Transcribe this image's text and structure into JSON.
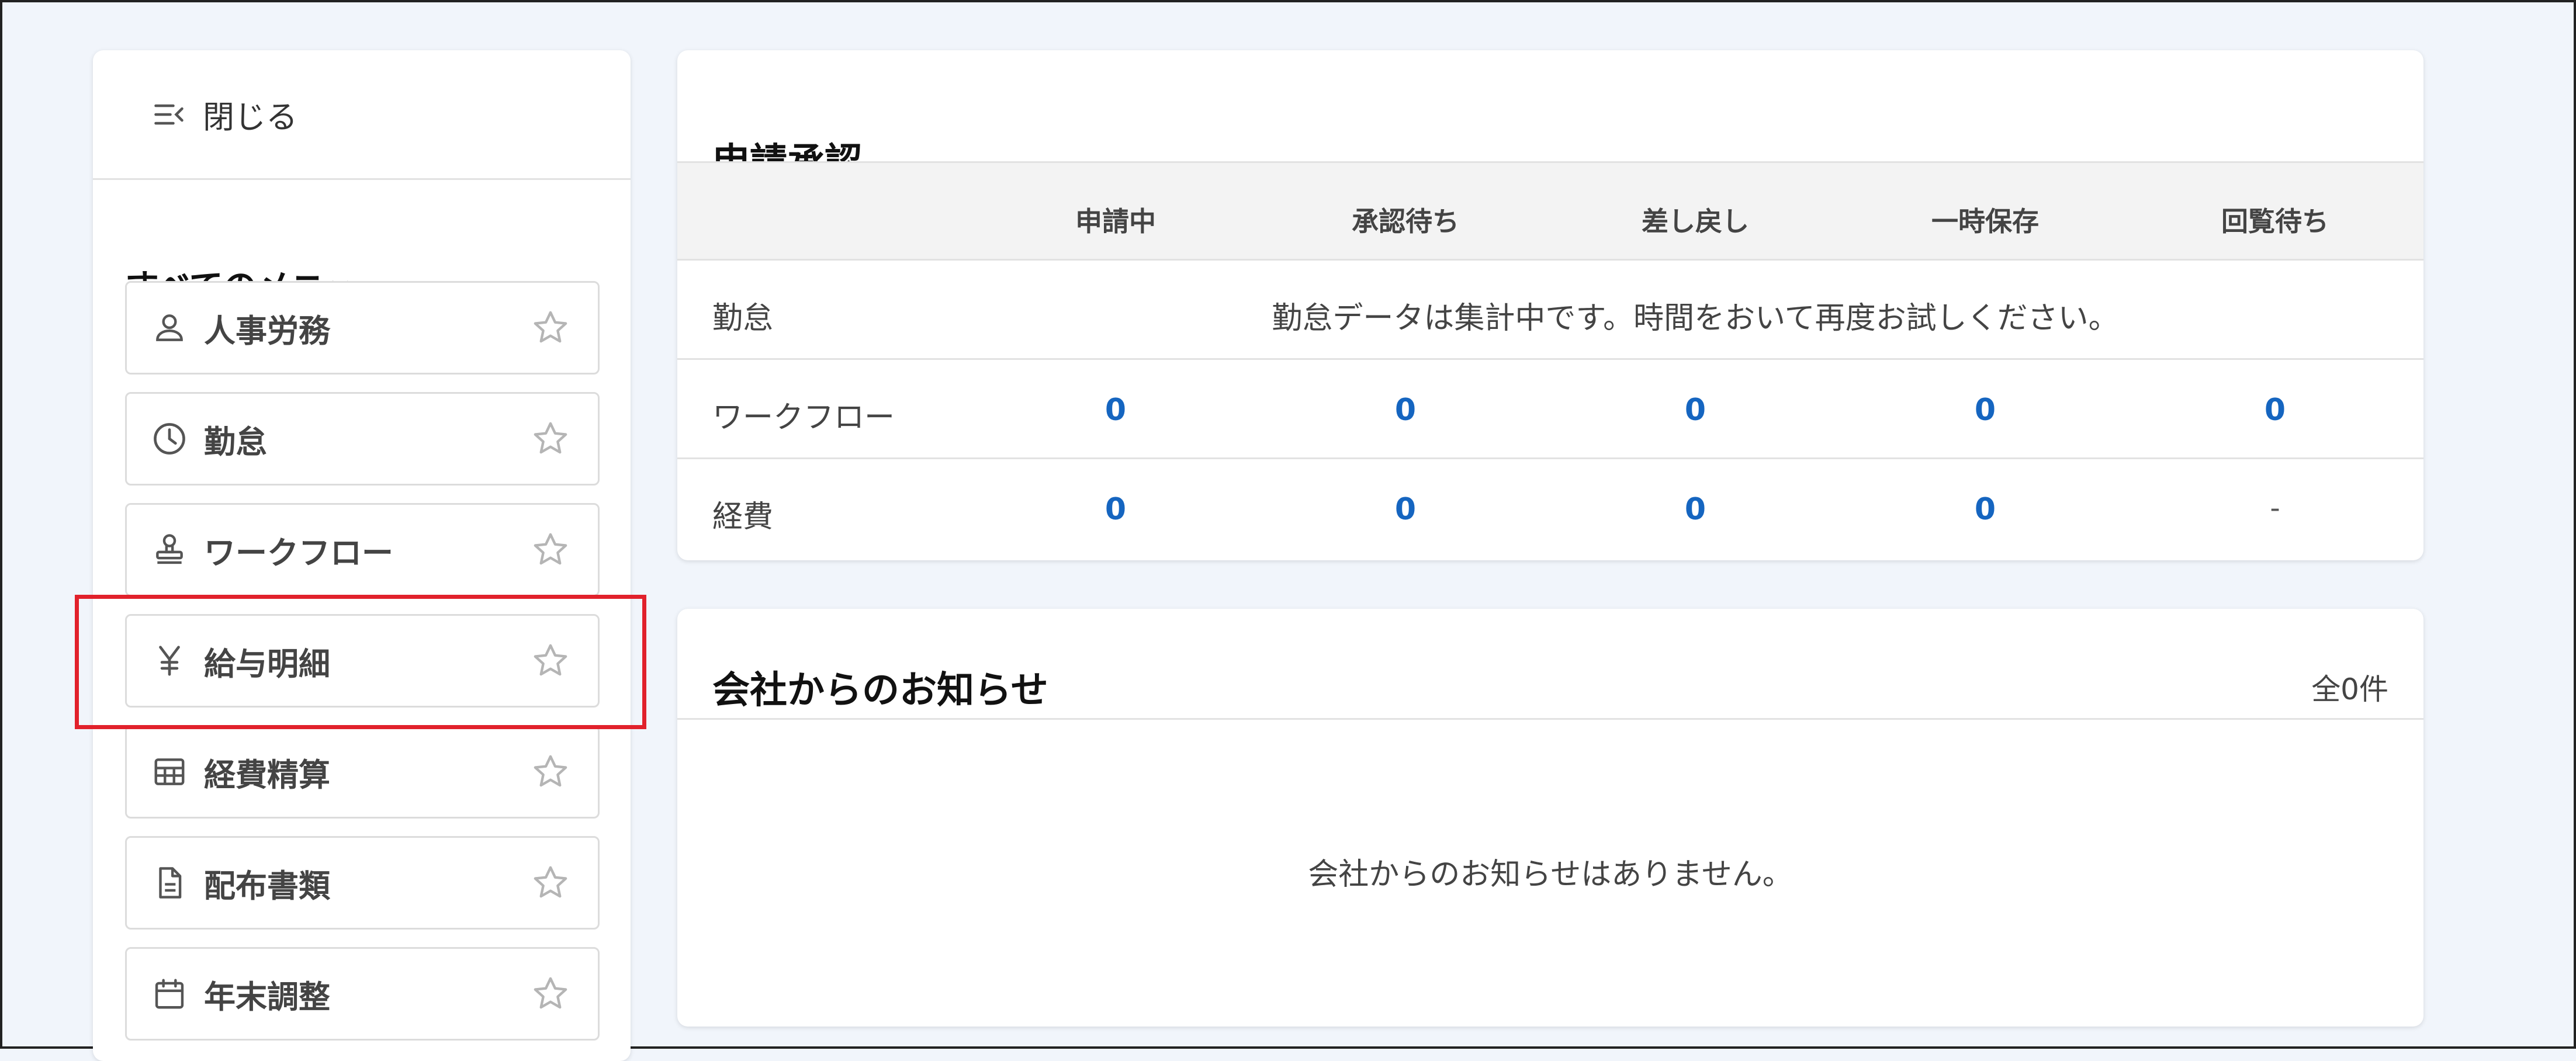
{
  "sidebar": {
    "close_label": "閉じる",
    "menu_title": "すべてのメニュー",
    "items": [
      {
        "label": "人事労務",
        "icon": "person-icon"
      },
      {
        "label": "勤怠",
        "icon": "clock-icon"
      },
      {
        "label": "ワークフロー",
        "icon": "stamp-icon"
      },
      {
        "label": "給与明細",
        "icon": "yen-icon"
      },
      {
        "label": "経費精算",
        "icon": "calculator-icon"
      },
      {
        "label": "配布書類",
        "icon": "document-icon"
      },
      {
        "label": "年末調整",
        "icon": "calendar-icon"
      }
    ],
    "highlighted_item": "給与明細"
  },
  "approval": {
    "title": "申請承認",
    "columns": [
      "申請中",
      "承認待ち",
      "差し戻し",
      "一時保存",
      "回覧待ち"
    ],
    "rows": [
      {
        "label": "勤怠",
        "message": "勤怠データは集計中です。時間をおいて再度お試しください。"
      },
      {
        "label": "ワークフロー",
        "values": [
          "0",
          "0",
          "0",
          "0",
          "0"
        ]
      },
      {
        "label": "経費",
        "values": [
          "0",
          "0",
          "0",
          "0",
          "-"
        ]
      }
    ]
  },
  "notice": {
    "title": "会社からのお知らせ",
    "count": "全0件",
    "empty_message": "会社からのお知らせはありません。"
  },
  "colors": {
    "background": "#f1f5fb",
    "link_blue": "#1565c0",
    "highlight_red": "#e1212b"
  }
}
